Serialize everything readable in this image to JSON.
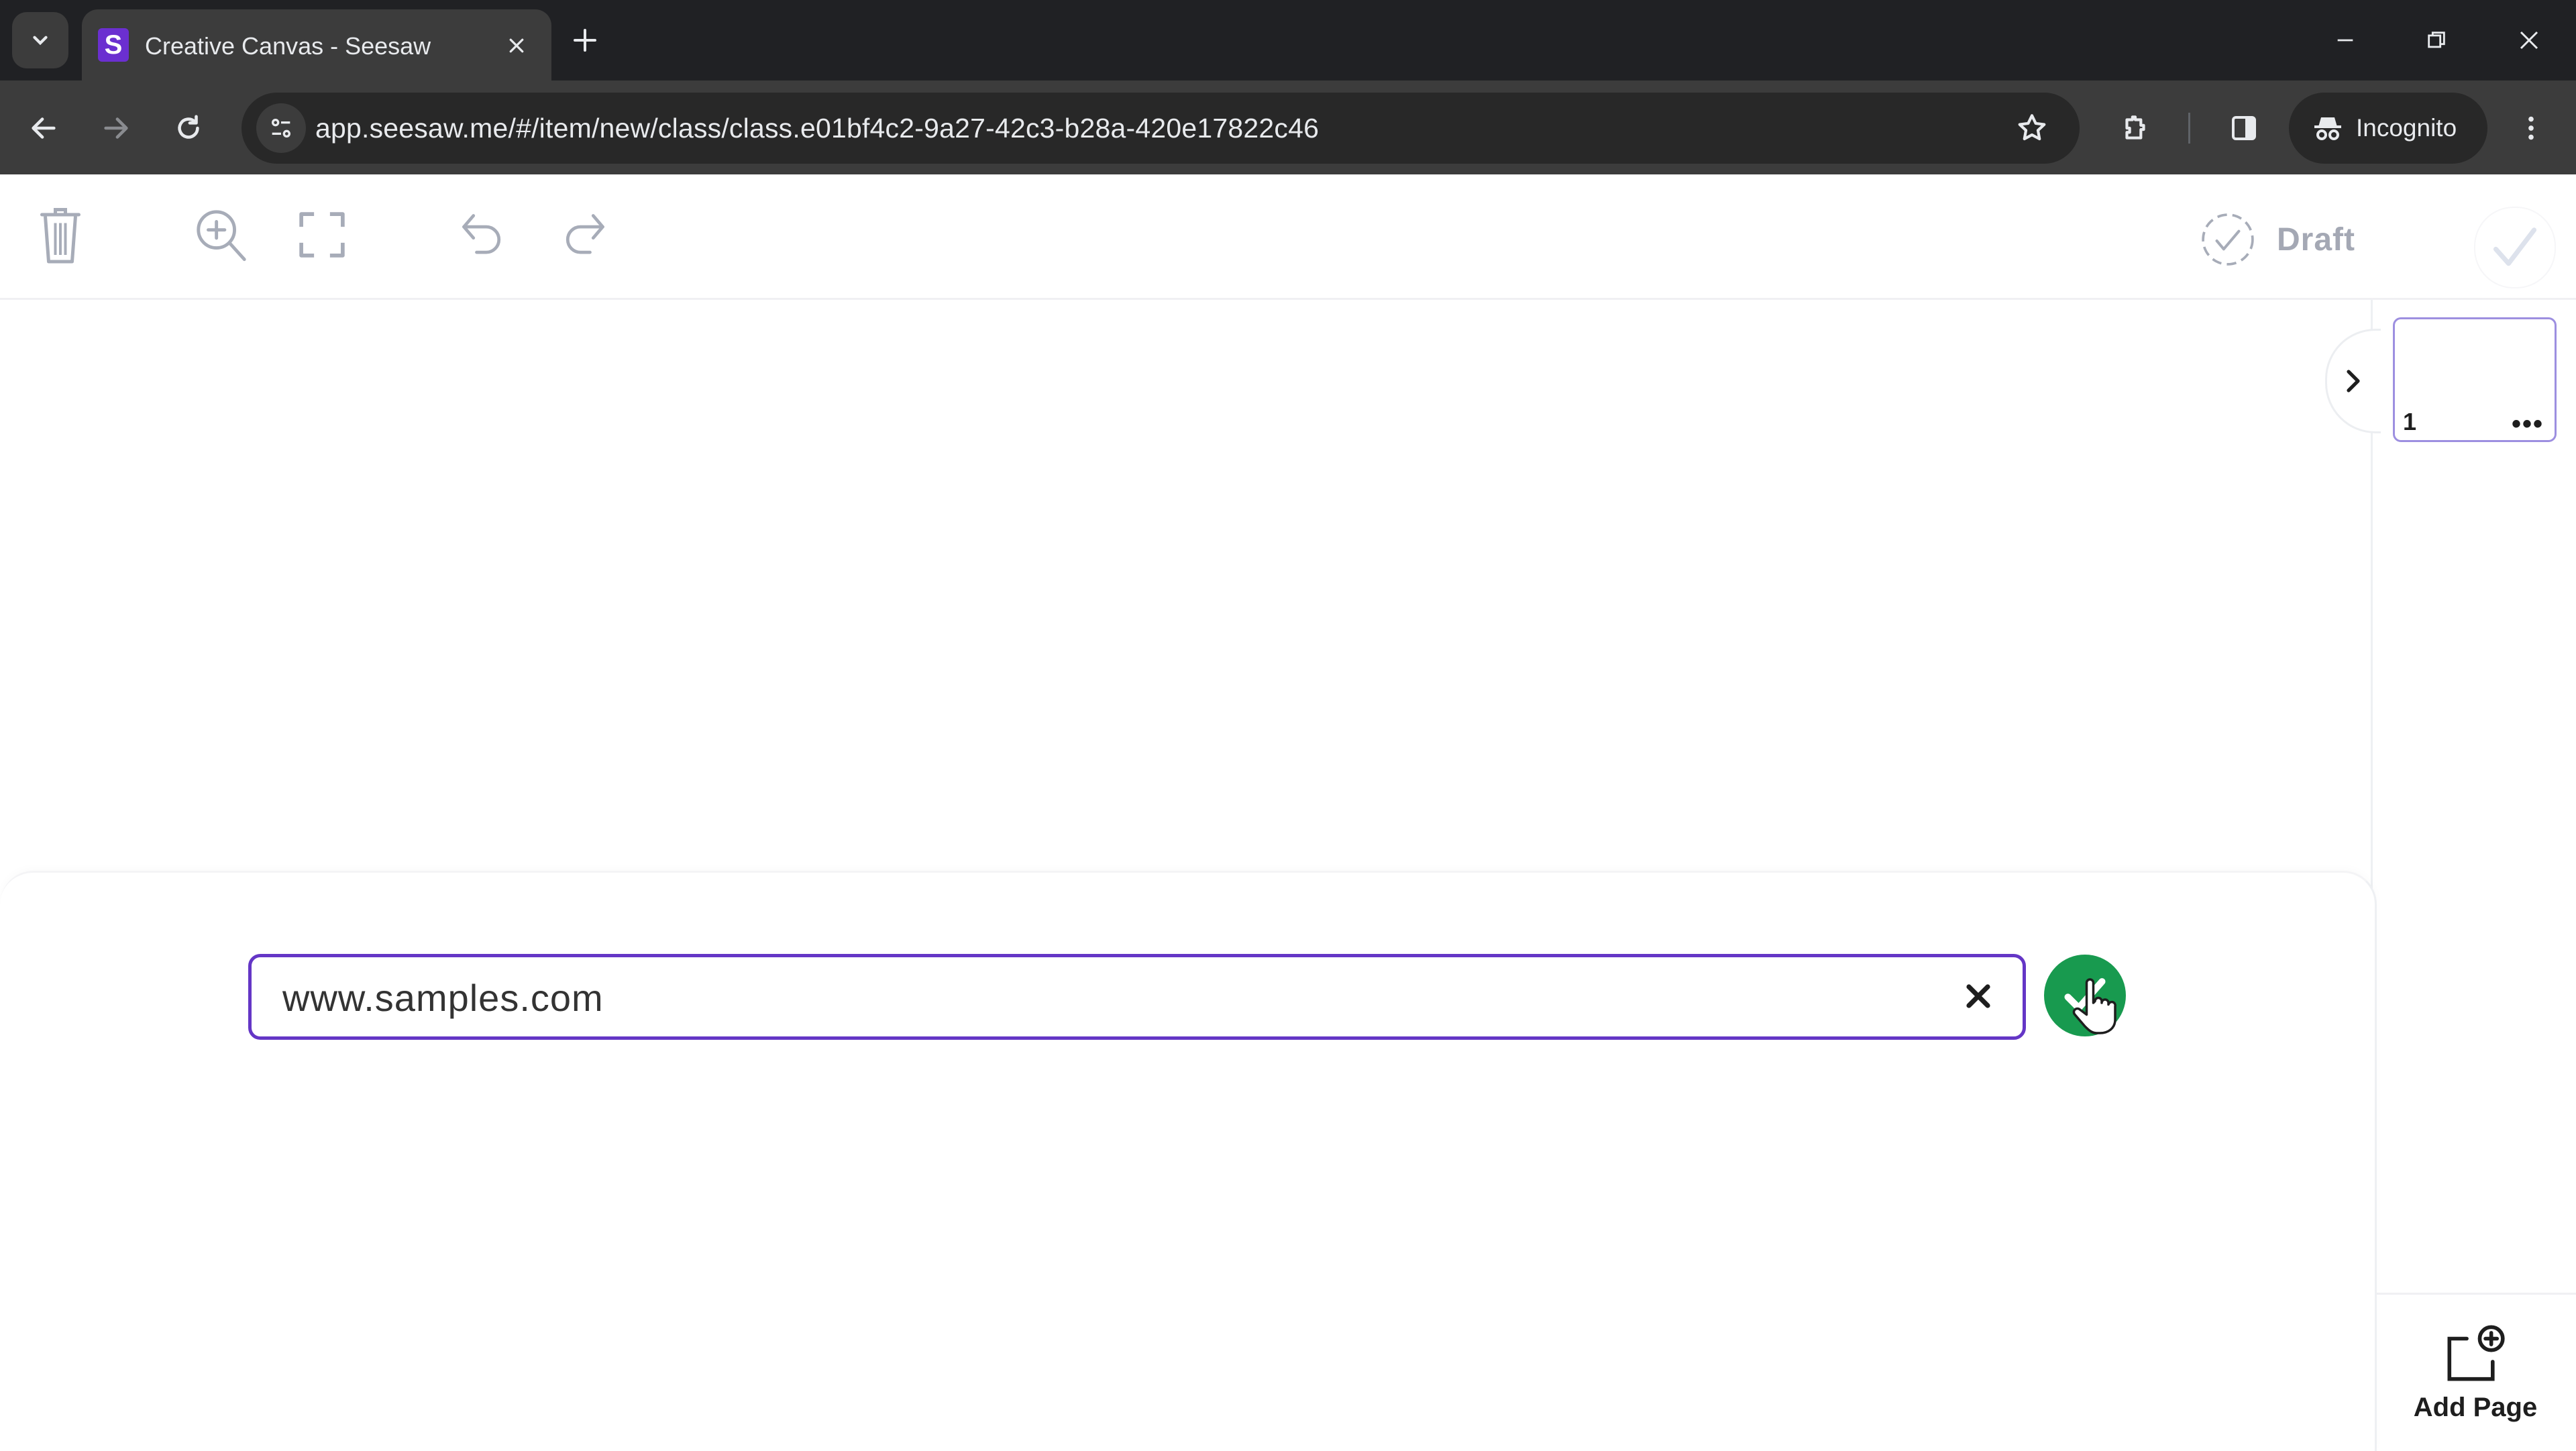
{
  "browser": {
    "tab": {
      "title": "Creative Canvas - Seesaw",
      "favicon_letter": "S",
      "favicon_color": "#6b2fd0"
    },
    "url": "app.seesaw.me/#/item/new/class/class.e01bf4c2-9a27-42c3-b28a-420e17822c46",
    "profile_label": "Incognito",
    "icons": [
      "tab-search-icon",
      "close-icon",
      "plus-icon",
      "minimize-icon",
      "restore-icon",
      "window-close-icon",
      "back-icon",
      "forward-icon",
      "reload-icon",
      "site-info-icon",
      "bookmark-star-icon",
      "extensions-icon",
      "side-panel-icon",
      "incognito-icon",
      "kebab-menu-icon"
    ]
  },
  "app_toolbar": {
    "tools": [
      "trash-icon",
      "zoom-in-icon",
      "fullscreen-icon",
      "undo-icon",
      "redo-icon"
    ],
    "status_label": "Draft",
    "status_icon": "dashed-check-circle-icon",
    "post_icon": "checkmark-icon"
  },
  "pages": {
    "thumbnails": [
      {
        "number": "1",
        "more_label": "•••"
      }
    ],
    "add_page_label": "Add Page"
  },
  "link_panel": {
    "input_value": "www.samples.com",
    "accent_color": "#6436c6",
    "confirm_color": "#189a4f"
  }
}
